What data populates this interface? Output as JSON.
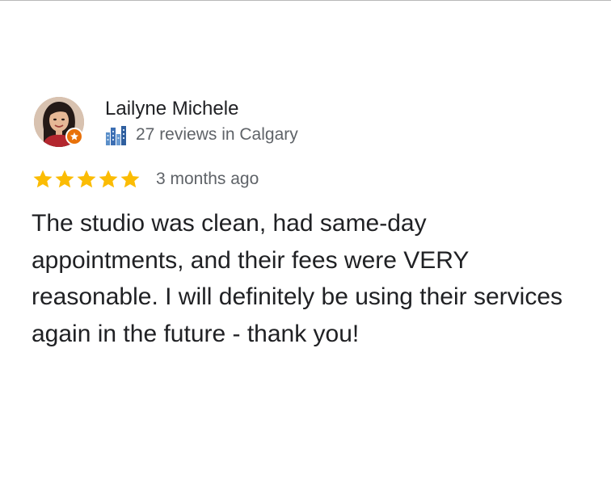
{
  "review": {
    "reviewer_name": "Lailyne Michele",
    "reviewer_meta": "27 reviews in Calgary",
    "rating": 5,
    "rating_max": 5,
    "time_ago": "3 months ago",
    "text": "The studio was clean, had same-day appointments, and their fees were VERY reasonable. I will definitely be using their services again in the future - thank you!"
  },
  "colors": {
    "star": "#fbbc04",
    "local_guide_badge": "#e8710a",
    "name_text": "#202124",
    "secondary_text": "#5f6368"
  },
  "icons": {
    "avatar": "avatar",
    "badge": "local-guide-badge-icon",
    "meta": "city-skyline-icon",
    "star": "star-icon"
  }
}
